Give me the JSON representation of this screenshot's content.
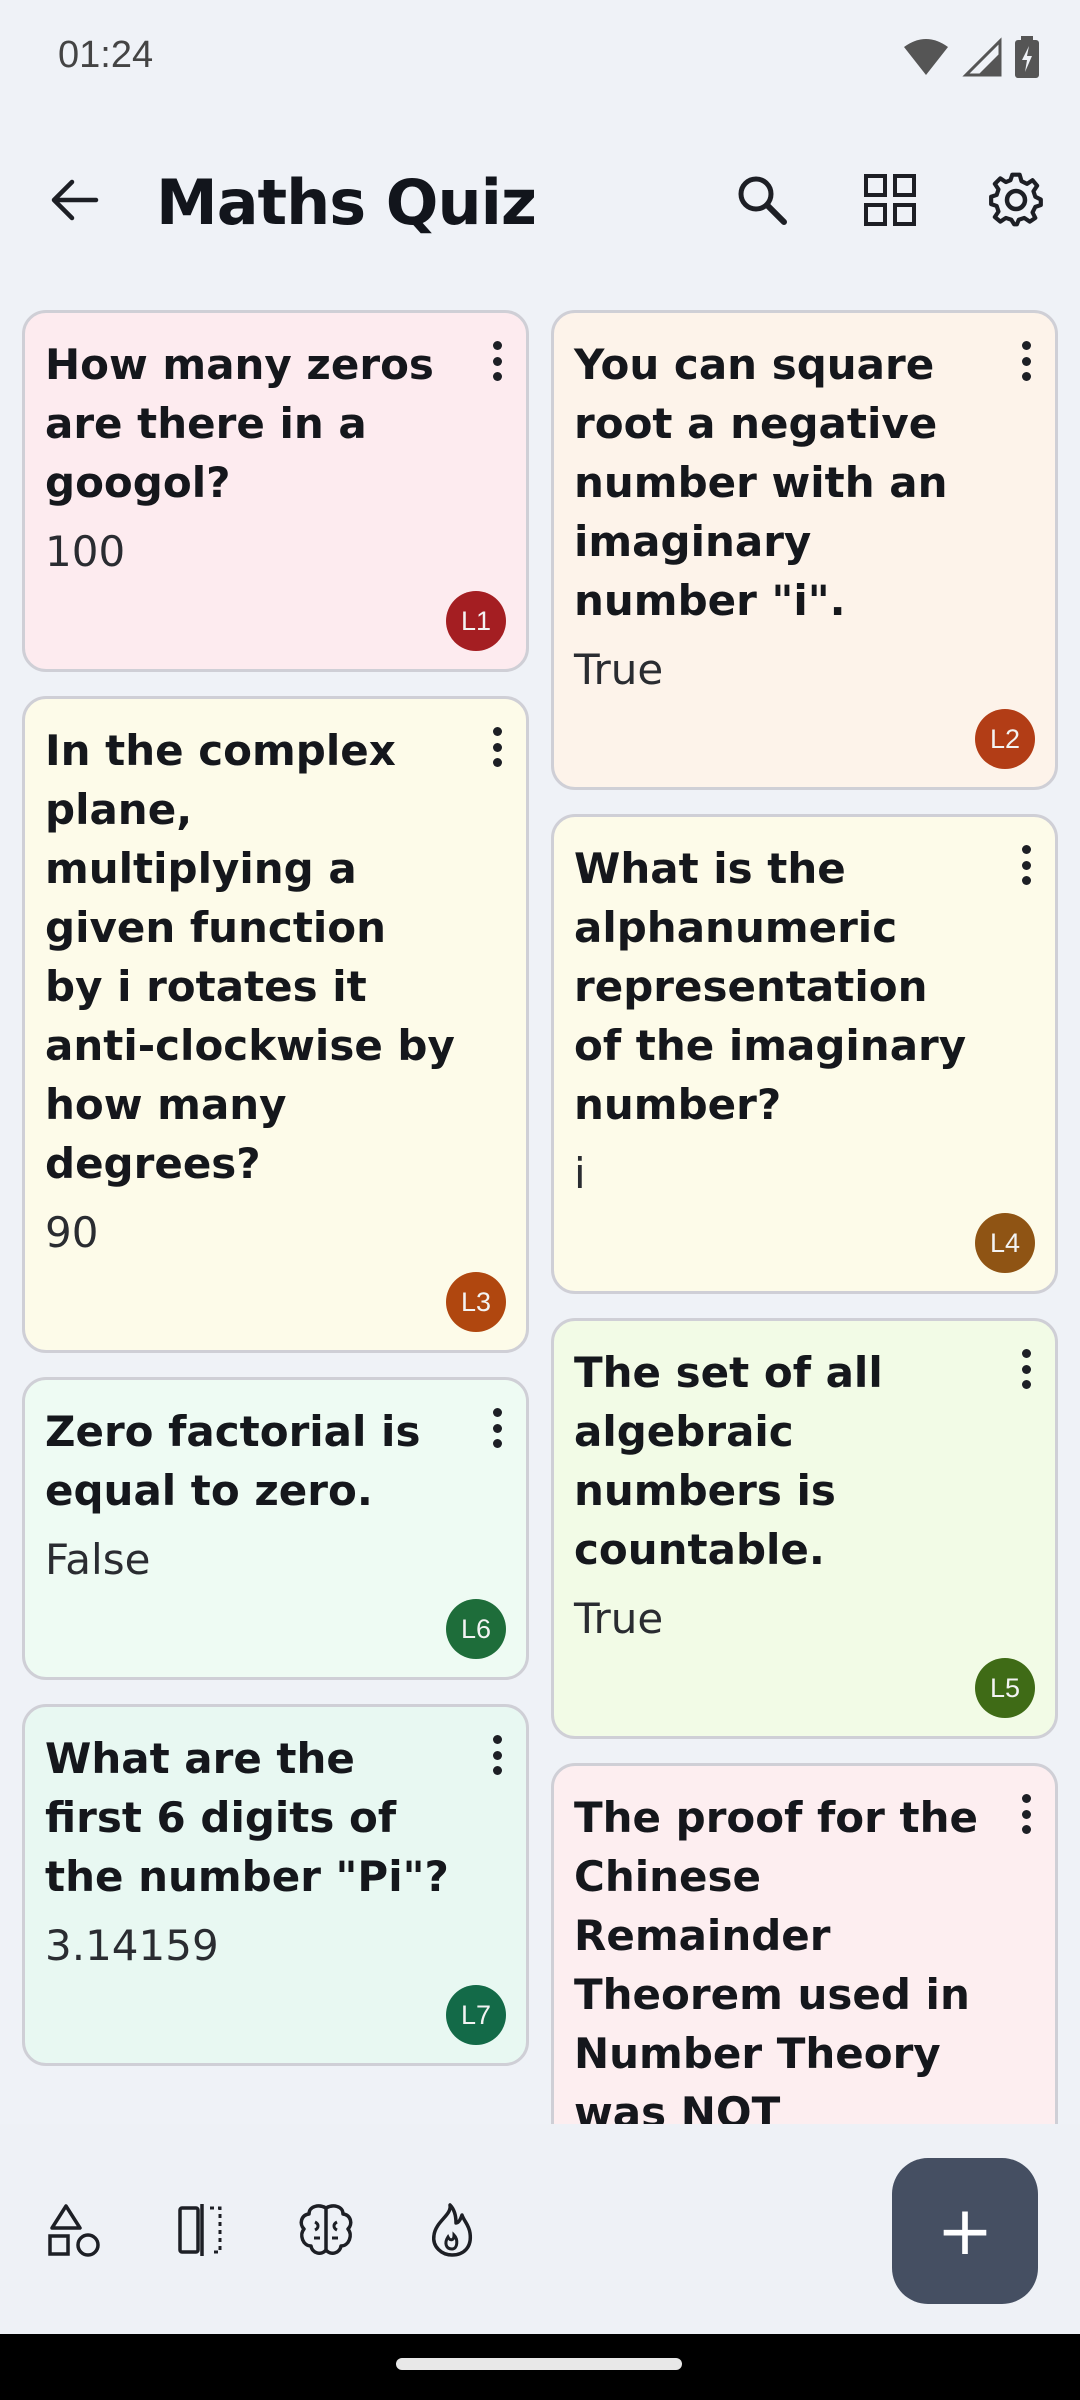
{
  "status_bar": {
    "time": "01:24"
  },
  "app_bar": {
    "title": "Maths Quiz",
    "icons": [
      "back-arrow-icon",
      "search-icon",
      "grid-view-icon",
      "settings-icon"
    ]
  },
  "cards": {
    "left": [
      {
        "question": "How many zeros are there in a googol?",
        "answer": "100",
        "badge": "L1",
        "bg": "#fdebef",
        "badge_color": "#a41e22"
      },
      {
        "question": "In the complex plane, multiplying a given function by i rotates it anti-clockwise by how many degrees?",
        "answer": "90",
        "badge": "L3",
        "bg": "#fdfbe9",
        "badge_color": "#b0470f"
      },
      {
        "question": "Zero factorial is equal to zero.",
        "answer": "False",
        "badge": "L6",
        "bg": "#eefbf3",
        "badge_color": "#1e6d3a"
      },
      {
        "question": "What are the first 6 digits of the number \"Pi\"?",
        "answer": "3.14159",
        "badge": "L7",
        "bg": "#e8f8f2",
        "badge_color": "#136a48"
      }
    ],
    "right": [
      {
        "question": "You can square root a negative number with an imaginary number \"i\".",
        "answer": "True",
        "badge": "L2",
        "bg": "#fdf3ea",
        "badge_color": "#b23d16"
      },
      {
        "question": "What is the alphanumeric representation of the imaginary number?",
        "answer": "i",
        "badge": "L4",
        "bg": "#fdfbe9",
        "badge_color": "#8f5414"
      },
      {
        "question": "The set of all algebraic numbers is countable.",
        "answer": "True",
        "badge": "L5",
        "bg": "#f2fbe6",
        "badge_color": "#3f6b16"
      },
      {
        "question": "The proof for the Chinese Remainder Theorem used in Number Theory was NOT",
        "answer": "",
        "badge": "",
        "bg": "#fdeef0",
        "badge_color": "#a41e22"
      }
    ]
  },
  "bottom_bar": {
    "icons": [
      "shapes-icon",
      "compare-icon",
      "brain-icon",
      "flame-icon"
    ],
    "fab_label": "+"
  }
}
